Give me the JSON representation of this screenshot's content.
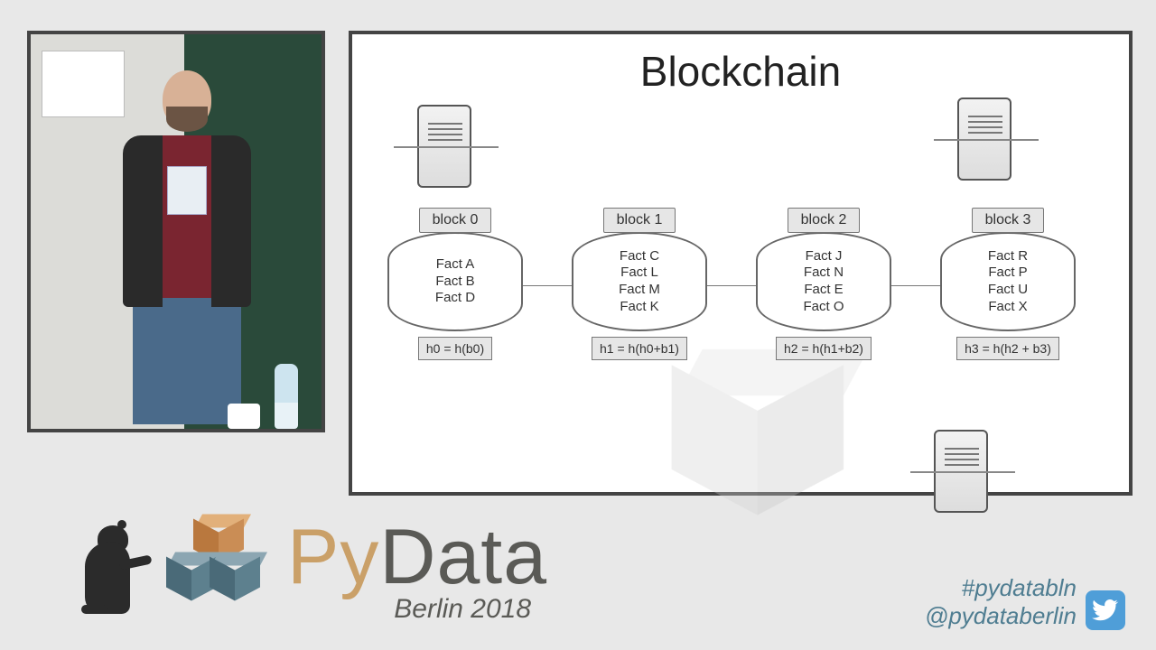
{
  "event": {
    "name_prefix": "Py",
    "name_suffix": "Data",
    "location_year": "Berlin 2018"
  },
  "social": {
    "hashtag": "#pydatabln",
    "handle": "@pydataberlin"
  },
  "slide": {
    "title": "Blockchain",
    "blocks": [
      {
        "label": "block 0",
        "facts": [
          "Fact A",
          "Fact B",
          "Fact D"
        ],
        "hash": "h0 = h(b0)"
      },
      {
        "label": "block 1",
        "facts": [
          "Fact C",
          "Fact L",
          "Fact M",
          "Fact K"
        ],
        "hash": "h1 = h(h0+b1)"
      },
      {
        "label": "block 2",
        "facts": [
          "Fact J",
          "Fact N",
          "Fact E",
          "Fact O"
        ],
        "hash": "h2 = h(h1+b2)"
      },
      {
        "label": "block 3",
        "facts": [
          "Fact R",
          "Fact P",
          "Fact U",
          "Fact X"
        ],
        "hash": "h3 = h(h2 + b3)"
      }
    ]
  }
}
